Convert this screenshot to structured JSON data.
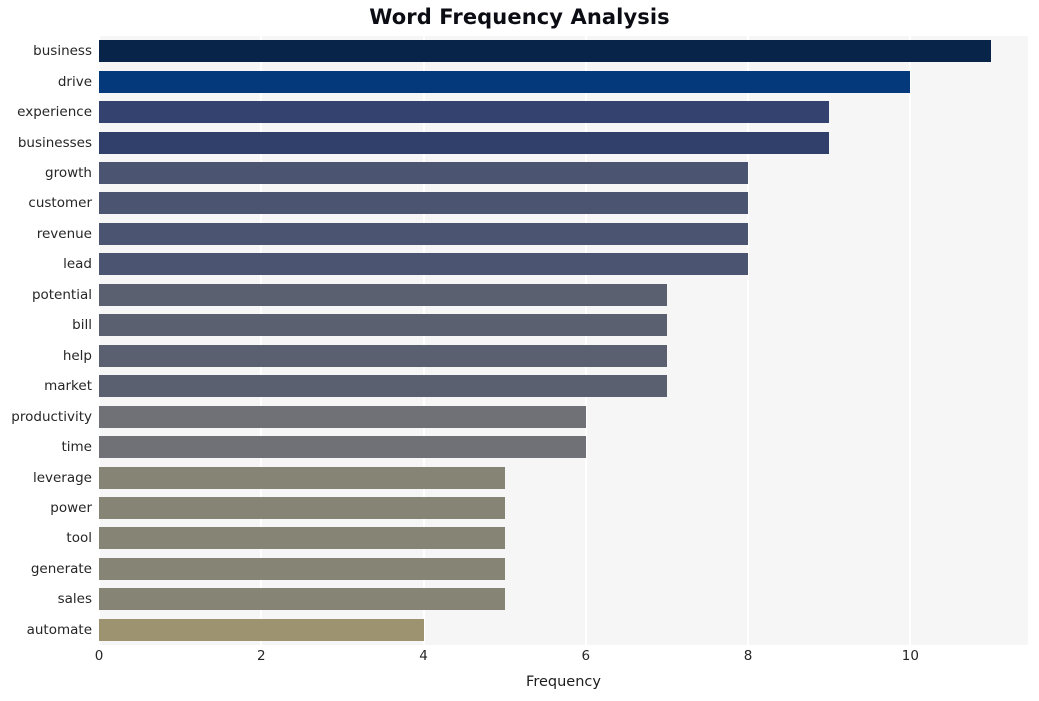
{
  "chart_data": {
    "type": "bar",
    "orientation": "horizontal",
    "title": "Word Frequency Analysis",
    "xlabel": "Frequency",
    "ylabel": "",
    "xlim": [
      0,
      11.45
    ],
    "ylim": [
      0,
      20
    ],
    "grid": "vertical-white-on-light-gray",
    "legend": null,
    "xticks": [
      0,
      2,
      4,
      6,
      8,
      10
    ],
    "xtick_labels": [
      "0",
      "2",
      "4",
      "6",
      "8",
      "10"
    ],
    "categories": [
      "business",
      "drive",
      "experience",
      "businesses",
      "growth",
      "customer",
      "revenue",
      "lead",
      "potential",
      "bill",
      "help",
      "market",
      "productivity",
      "time",
      "leverage",
      "power",
      "tool",
      "generate",
      "sales",
      "automate"
    ],
    "values": [
      11,
      10,
      9,
      9,
      8,
      8,
      8,
      8,
      7,
      7,
      7,
      7,
      6,
      6,
      5,
      5,
      5,
      5,
      5,
      4
    ],
    "bar_colors": [
      "#082549",
      "#043a7b",
      "#33426e",
      "#31406b",
      "#4b5471",
      "#4b5471",
      "#4b5471",
      "#4b5471",
      "#5b6070",
      "#5b6070",
      "#5b6070",
      "#5b6070",
      "#707177",
      "#707177",
      "#868475",
      "#868475",
      "#868475",
      "#868475",
      "#868475",
      "#9e9371"
    ],
    "plot_background": "#f6f6f7",
    "figure_background": "#ffffff",
    "title_color": "#0c0c14",
    "tick_color": "#262626"
  }
}
